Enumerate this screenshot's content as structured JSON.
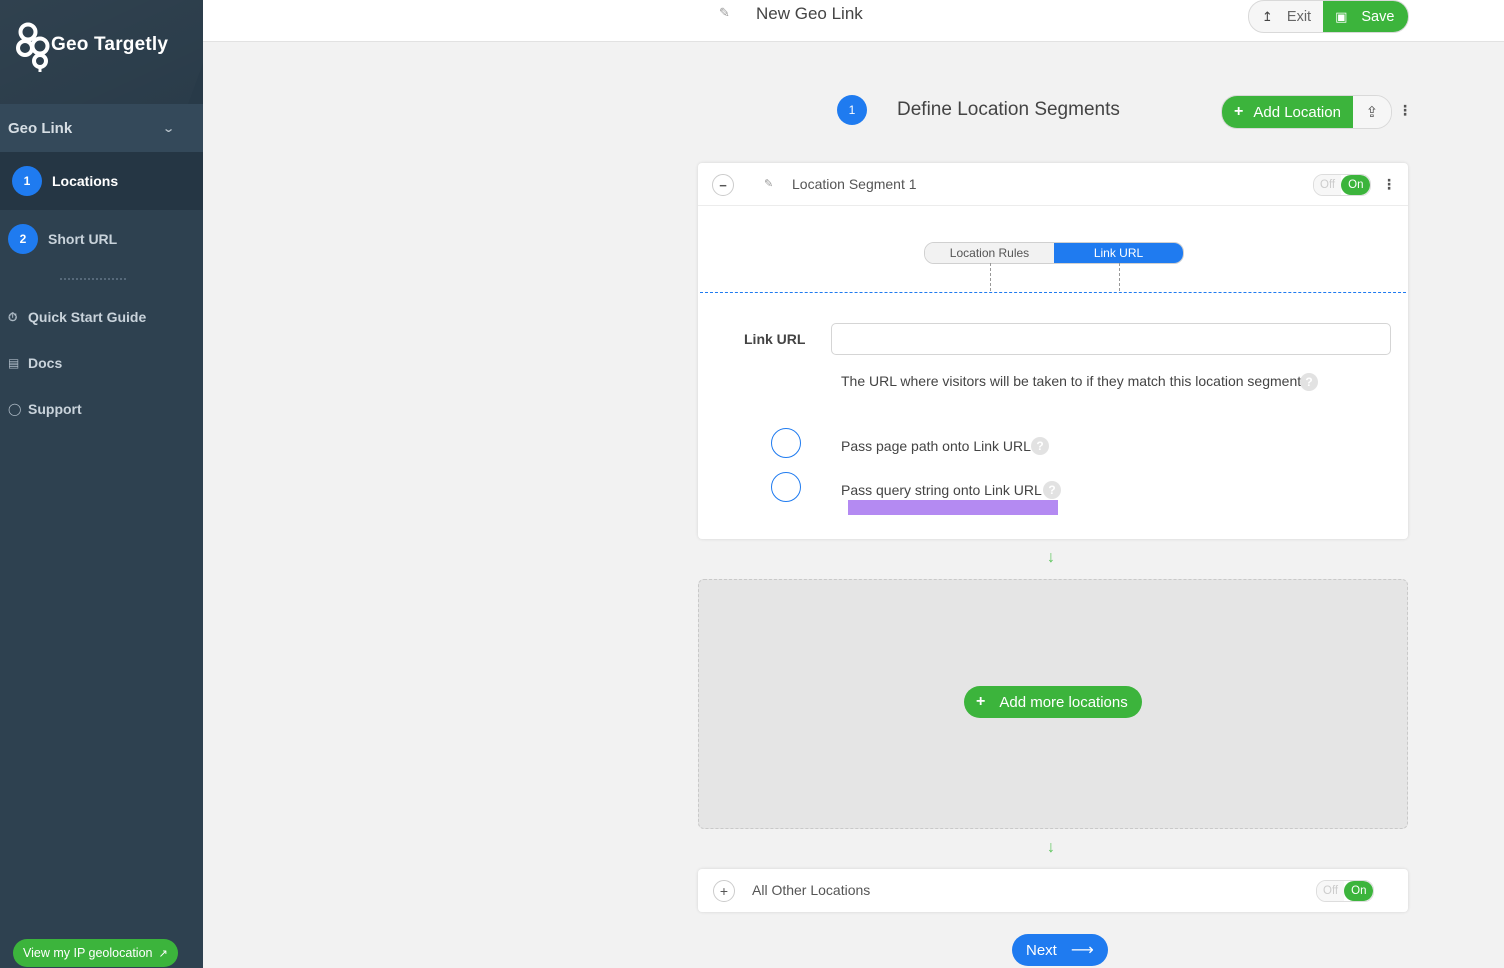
{
  "sidebar": {
    "brand": "Geo Targetly",
    "module": "Geo Link",
    "steps": [
      {
        "num": "1",
        "label": "Locations"
      },
      {
        "num": "2",
        "label": "Short URL"
      }
    ],
    "links": [
      {
        "label": "Quick Start Guide",
        "icon": "clock-icon"
      },
      {
        "label": "Docs",
        "icon": "book-icon"
      },
      {
        "label": "Support",
        "icon": "chat-icon"
      }
    ],
    "ip_button": "View my IP geolocation"
  },
  "topbar": {
    "title": "New Geo Link",
    "exit_label": "Exit",
    "save_label": "Save"
  },
  "section": {
    "num": "1",
    "title": "Define Location Segments",
    "add_location_label": "Add Location"
  },
  "segment": {
    "name": "Location Segment 1",
    "toggle_off": "Off",
    "toggle_on": "On",
    "tabs": [
      "Location Rules",
      "Link URL"
    ],
    "active_tab": "Link URL",
    "field_label": "Link URL",
    "link_url_value": "",
    "help_text": "The URL where visitors will be taken to if they match this location segment",
    "help_mark": "?",
    "options": [
      {
        "label": "Pass page path onto Link URL",
        "checked": false
      },
      {
        "label": "Pass query string onto Link URL",
        "checked": false
      }
    ]
  },
  "add_more_label": "Add more locations",
  "other": {
    "name": "All Other Locations",
    "toggle_off": "Off",
    "toggle_on": "On"
  },
  "next_label": "Next",
  "colors": {
    "sidebar_bg": "#2e4150",
    "accent_blue": "#1f7bf0",
    "accent_green": "#3cb43c",
    "highlight_purple": "#b48af2"
  }
}
